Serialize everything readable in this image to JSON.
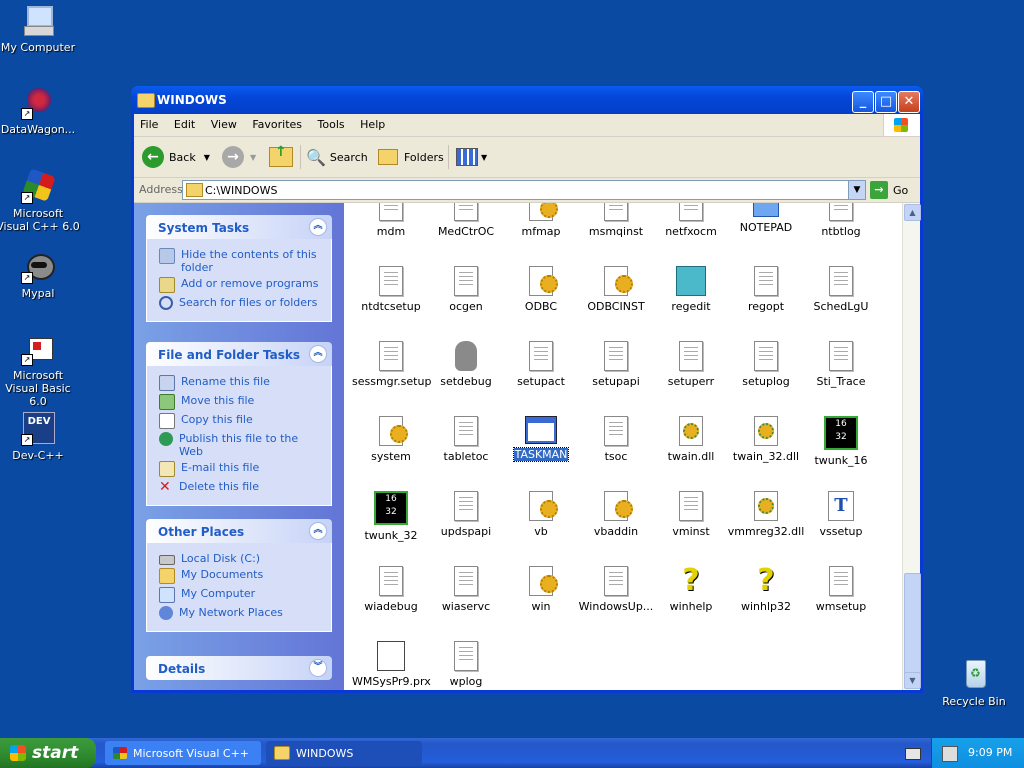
{
  "desktop": {
    "icons": [
      {
        "label": "My Computer",
        "icon": "my-computer-icon"
      },
      {
        "label": "DataWagon...",
        "icon": "datawagon-icon"
      },
      {
        "label": "Microsoft Visual C++ 6.0",
        "icon": "visual-cpp-icon"
      },
      {
        "label": "Mypal",
        "icon": "mypal-icon"
      },
      {
        "label": "Microsoft Visual Basic 6.0",
        "icon": "visual-basic-icon"
      },
      {
        "label": "Dev-C++",
        "icon": "devcpp-icon"
      },
      {
        "label": "Recycle Bin",
        "icon": "recycle-bin-icon"
      }
    ]
  },
  "window": {
    "title": "WINDOWS",
    "menu": [
      "File",
      "Edit",
      "View",
      "Favorites",
      "Tools",
      "Help"
    ],
    "toolbar": {
      "back": "Back",
      "search": "Search",
      "folders": "Folders"
    },
    "address": {
      "label": "Address",
      "value": "C:\\WINDOWS",
      "go": "Go"
    }
  },
  "taskpane": {
    "system_tasks": {
      "title": "System Tasks",
      "items": [
        "Hide the contents of this folder",
        "Add or remove programs",
        "Search for files or folders"
      ]
    },
    "file_folder_tasks": {
      "title": "File and Folder Tasks",
      "items": [
        "Rename this file",
        "Move this file",
        "Copy this file",
        "Publish this file to the Web",
        "E-mail this file",
        "Delete this file"
      ]
    },
    "other_places": {
      "title": "Other Places",
      "items": [
        "Local Disk (C:)",
        "My Documents",
        "My Computer",
        "My Network Places"
      ]
    },
    "details": {
      "title": "Details"
    }
  },
  "files": [
    [
      "mdm",
      "MedCtrOC",
      "mfmap",
      "msmqinst",
      "netfxocm",
      "NOTEPAD",
      "ntbtlog"
    ],
    [
      "ntdtcsetup",
      "ocgen",
      "ODBC",
      "ODBCINST",
      "regedit",
      "regopt",
      "SchedLgU"
    ],
    [
      "sessmgr.setup",
      "setdebug",
      "setupact",
      "setupapi",
      "setuperr",
      "setuplog",
      "Sti_Trace"
    ],
    [
      "system",
      "tabletoc",
      "TASKMAN",
      "tsoc",
      "twain.dll",
      "twain_32.dll",
      "twunk_16"
    ],
    [
      "twunk_32",
      "updspapi",
      "vb",
      "vbaddin",
      "vminst",
      "vmmreg32.dll",
      "vssetup"
    ],
    [
      "wiadebug",
      "wiaservc",
      "win",
      "WindowsUp...",
      "winhelp",
      "winhlp32",
      "wmsetup"
    ],
    [
      "WMSysPr9.prx",
      "wplog"
    ]
  ],
  "selected_file": "TASKMAN",
  "badge_text": {
    "t16": "16",
    "t32": "32"
  },
  "taskbar": {
    "start": "start",
    "items": [
      "Microsoft Visual C++",
      "WINDOWS"
    ],
    "clock": "9:09 PM"
  }
}
